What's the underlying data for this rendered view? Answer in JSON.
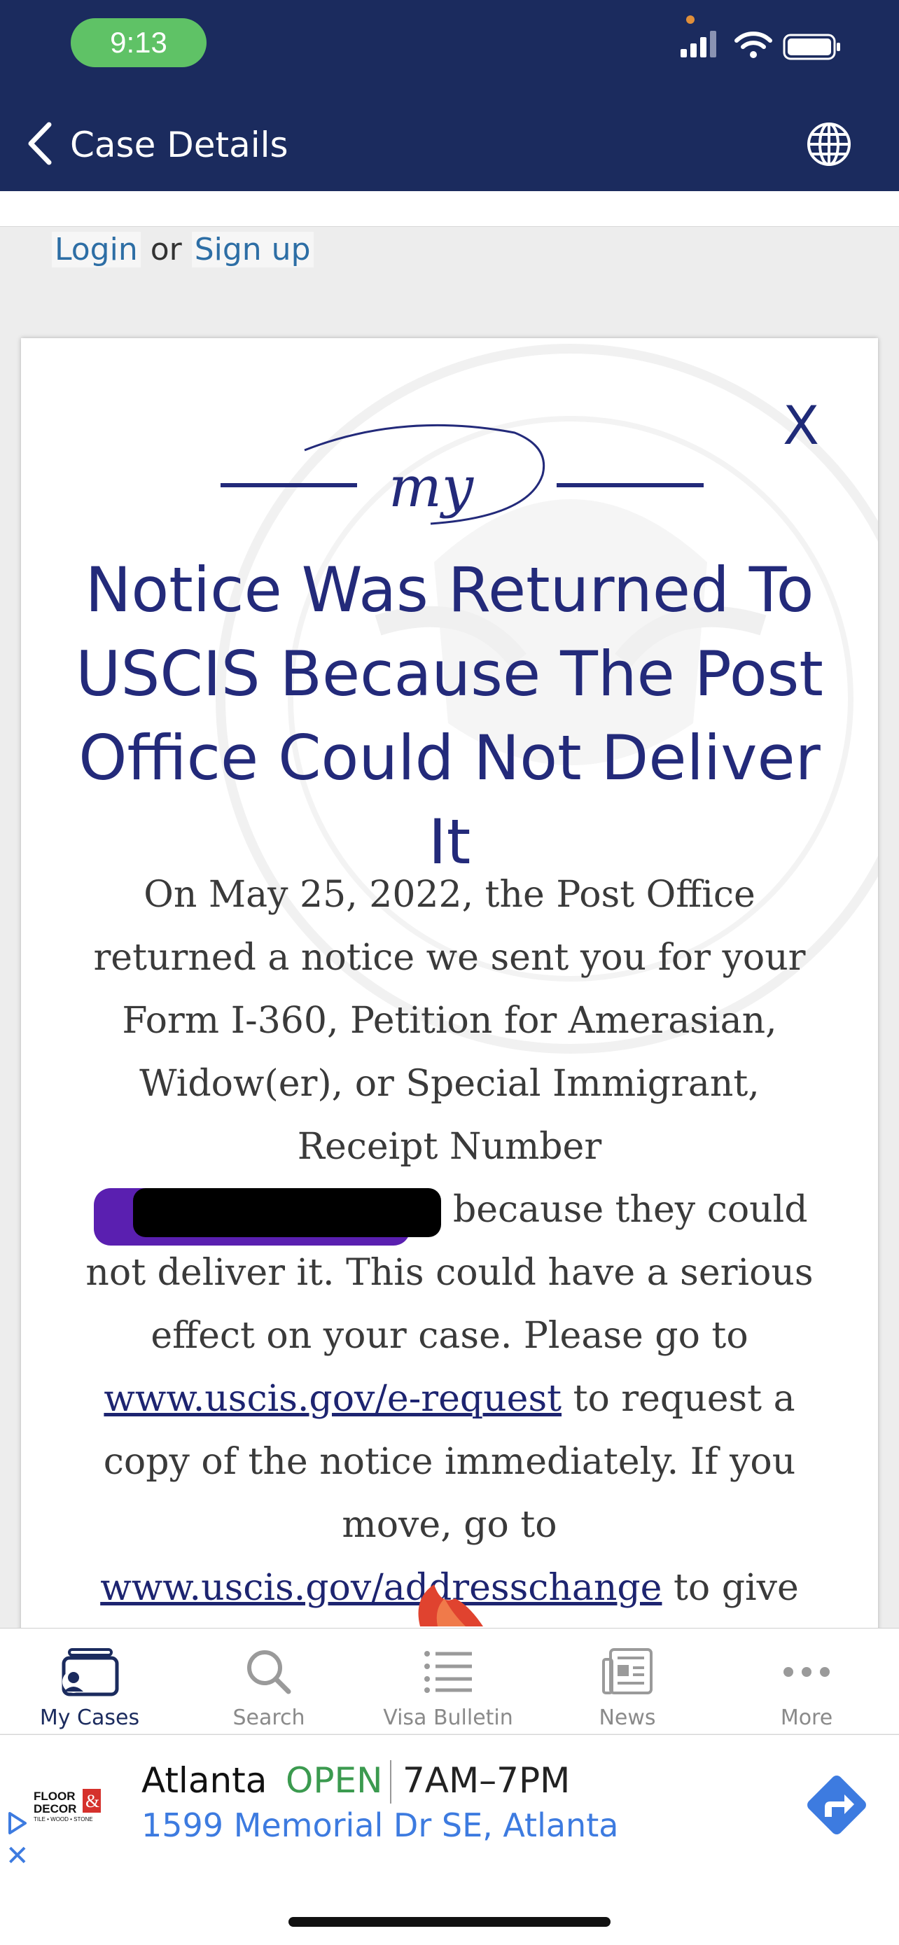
{
  "status_bar": {
    "time": "9:13"
  },
  "header": {
    "title": "Case Details",
    "back_icon": "chevron-left-icon",
    "globe_icon": "globe-icon",
    "bg": "#1b2b5e"
  },
  "auth": {
    "login": "Login",
    "or": "or",
    "signup": "Sign up"
  },
  "notice": {
    "close": "X",
    "logo_text": "my",
    "title_line1": "Notice Was Returned To",
    "title_line2": "USCIS Because The Post",
    "title_line3": "Office Could Not Deliver It",
    "body_part1": "On May 25, 2022, the Post Office returned a notice we sent you for your Form I-360, Petition for Amerasian, Widow(er), or Special Immigrant, Receipt Number",
    "body_part2": "because they could not deliver it. This could have a serious effect on your case. Please go to",
    "link1": "www.uscis.gov/e-request",
    "body_part3": "to request a copy of the notice immediately. If you move, go to",
    "link2": "www.uscis.gov/addresschange",
    "body_part4": "to give us your new mailing address.",
    "title_color": "#232a7a"
  },
  "tabs": [
    {
      "label": "My Cases",
      "icon": "my-cases-icon",
      "active": true
    },
    {
      "label": "Search",
      "icon": "search-icon",
      "active": false
    },
    {
      "label": "Visa Bulletin",
      "icon": "list-icon",
      "active": false
    },
    {
      "label": "News",
      "icon": "news-icon",
      "active": false
    },
    {
      "label": "More",
      "icon": "more-icon",
      "active": false
    }
  ],
  "ad": {
    "brand": "FLOOR & DECOR",
    "brand_tag": "TILE • WOOD • STONE",
    "city": "Atlanta",
    "status": "OPEN",
    "hours": "7AM–7PM",
    "address": "1599 Memorial Dr SE, Atlanta",
    "close": "✕",
    "status_color": "#3b9a4f",
    "link_color": "#3d7be0"
  }
}
